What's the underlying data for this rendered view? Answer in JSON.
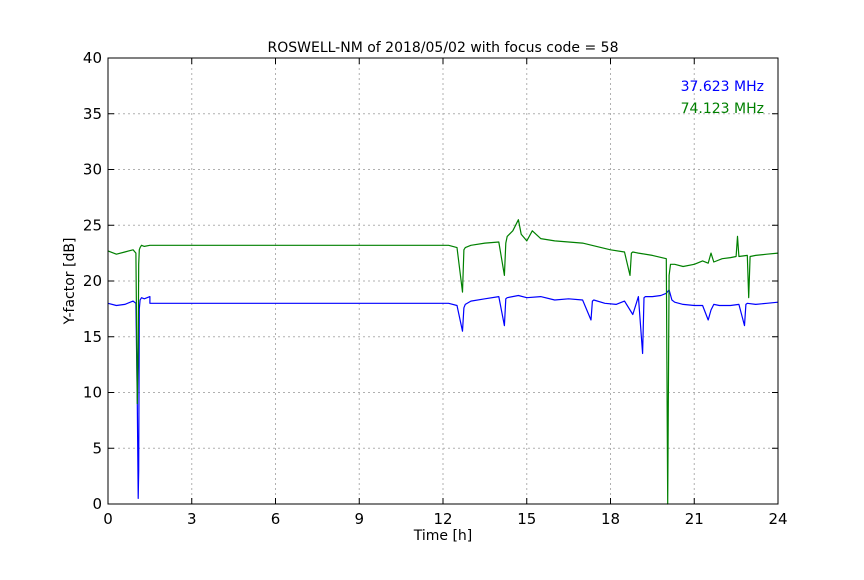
{
  "chart_data": {
    "type": "line",
    "title": "ROSWELL-NM of 2018/05/02 with focus code = 58",
    "xlabel": "Time [h]",
    "ylabel": "Y-factor [dB]",
    "xlim": [
      0,
      24
    ],
    "ylim": [
      0,
      40
    ],
    "xticks": [
      0,
      3,
      6,
      9,
      12,
      15,
      18,
      21,
      24
    ],
    "yticks": [
      0,
      5,
      10,
      15,
      20,
      25,
      30,
      35,
      40
    ],
    "grid": true,
    "legend_position": "top-right",
    "series": [
      {
        "name": "37.623 MHz",
        "color": "#0000ff",
        "x": [
          0.0,
          0.3,
          0.6,
          0.9,
          1.0,
          1.05,
          1.08,
          1.1,
          1.12,
          1.15,
          1.2,
          1.3,
          1.5,
          1.5,
          12.2,
          12.5,
          12.7,
          12.75,
          12.8,
          13.0,
          13.5,
          14.0,
          14.2,
          14.25,
          14.3,
          14.7,
          15.0,
          15.5,
          16.0,
          16.5,
          17.0,
          17.3,
          17.35,
          17.4,
          17.8,
          18.2,
          18.5,
          18.8,
          19.0,
          19.15,
          19.2,
          19.25,
          19.5,
          19.8,
          20.0,
          20.1,
          20.2,
          20.3,
          20.6,
          21.0,
          21.3,
          21.5,
          21.6,
          21.7,
          21.9,
          22.3,
          22.6,
          22.8,
          22.85,
          22.9,
          23.2,
          23.6,
          24.0
        ],
        "y": [
          18.0,
          17.8,
          17.9,
          18.2,
          18.0,
          9.0,
          0.5,
          3.0,
          17.5,
          18.3,
          18.5,
          18.4,
          18.6,
          18.0,
          18.0,
          17.8,
          15.5,
          17.6,
          17.9,
          18.2,
          18.4,
          18.6,
          16.0,
          18.4,
          18.5,
          18.7,
          18.5,
          18.6,
          18.3,
          18.4,
          18.3,
          16.5,
          18.2,
          18.3,
          18.0,
          17.9,
          18.2,
          17.0,
          18.6,
          13.5,
          18.5,
          18.6,
          18.6,
          18.7,
          18.9,
          19.2,
          18.3,
          18.1,
          17.9,
          17.8,
          17.8,
          16.5,
          17.4,
          17.9,
          17.8,
          17.8,
          17.9,
          16.0,
          17.9,
          18.0,
          17.9,
          18.0,
          18.1
        ]
      },
      {
        "name": "74.123 MHz",
        "color": "#008000",
        "x": [
          0.0,
          0.3,
          0.6,
          0.9,
          1.0,
          1.05,
          1.08,
          1.1,
          1.12,
          1.15,
          1.2,
          1.3,
          1.5,
          1.5,
          12.2,
          12.5,
          12.7,
          12.75,
          12.8,
          13.0,
          13.5,
          14.0,
          14.2,
          14.25,
          14.3,
          14.5,
          14.7,
          14.8,
          15.0,
          15.2,
          15.5,
          16.0,
          16.5,
          17.0,
          17.5,
          18.0,
          18.5,
          18.7,
          18.75,
          18.8,
          19.0,
          19.5,
          20.0,
          20.05,
          20.1,
          20.15,
          20.3,
          20.6,
          21.0,
          21.3,
          21.5,
          21.6,
          21.7,
          22.0,
          22.3,
          22.5,
          22.55,
          22.6,
          22.9,
          22.95,
          23.0,
          23.2,
          23.6,
          24.0
        ],
        "y": [
          22.7,
          22.4,
          22.6,
          22.8,
          22.5,
          9.0,
          14.0,
          21.5,
          22.8,
          23.0,
          23.2,
          23.1,
          23.2,
          23.2,
          23.2,
          23.0,
          19.0,
          22.8,
          23.0,
          23.2,
          23.4,
          23.5,
          20.5,
          23.4,
          24.0,
          24.5,
          25.5,
          24.2,
          23.6,
          24.5,
          23.8,
          23.6,
          23.5,
          23.4,
          23.1,
          22.8,
          22.6,
          20.5,
          22.5,
          22.6,
          22.5,
          22.3,
          22.0,
          0.0,
          20.5,
          21.5,
          21.5,
          21.3,
          21.5,
          21.8,
          21.6,
          22.5,
          21.7,
          22.0,
          22.1,
          22.2,
          24.0,
          22.2,
          22.3,
          18.5,
          22.2,
          22.3,
          22.4,
          22.5
        ]
      }
    ]
  }
}
